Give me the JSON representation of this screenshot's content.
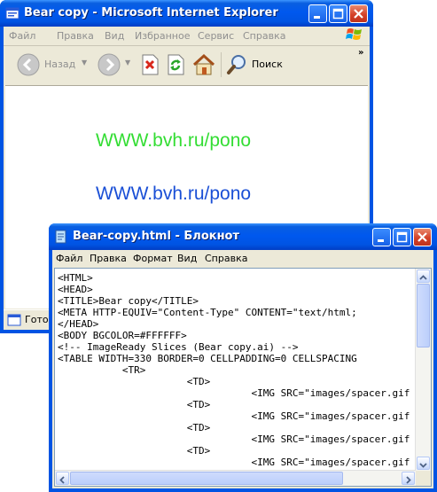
{
  "ie": {
    "title": "Bear copy - Microsoft Internet Explorer",
    "menu": [
      "Файл",
      "Правка",
      "Вид",
      "Избранное",
      "Сервис",
      "Справка"
    ],
    "toolbar": {
      "back_label": "Назад",
      "search_label": "Поиск"
    },
    "content": {
      "link1": {
        "text": "WWW.bvh.ru/pono",
        "color": "#33dd33"
      },
      "link2": {
        "text": "WWW.bvh.ru/pono",
        "color": "#1a4fd6"
      }
    },
    "status": {
      "text": "Готов"
    }
  },
  "notepad": {
    "title": "Bear-copy.html - Блокнот",
    "menu": [
      "Файл",
      "Правка",
      "Формат",
      "Вид",
      "Справка"
    ],
    "lines": [
      "<HTML>",
      "<HEAD>",
      "<TITLE>Bear copy</TITLE>",
      "<META HTTP-EQUIV=\"Content-Type\" CONTENT=\"text/html;",
      "</HEAD>",
      "<BODY BGCOLOR=#FFFFFF>",
      "<!-- ImageReady Slices (Bear copy.ai) -->",
      "<TABLE WIDTH=330 BORDER=0 CELLPADDING=0 CELLSPACING",
      "           <TR>",
      "                      <TD>",
      "                                 <IMG SRC=\"images/spacer.gif",
      "                      <TD>",
      "                                 <IMG SRC=\"images/spacer.gif",
      "                      <TD>",
      "                                 <IMG SRC=\"images/spacer.gif",
      "                      <TD>",
      "                                 <IMG SRC=\"images/spacer.gif"
    ]
  },
  "colors": {
    "titlebar": "#0054e3",
    "window_face": "#ece9d8",
    "close_button": "#d4422a"
  }
}
